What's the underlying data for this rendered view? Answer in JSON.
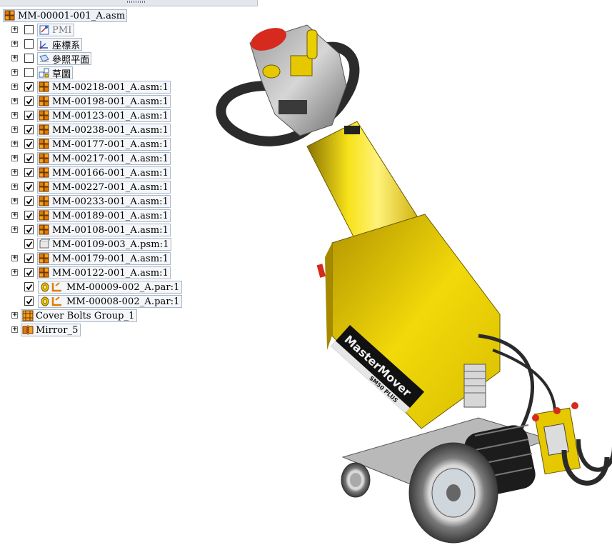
{
  "tree": {
    "root": {
      "label": "MM-00001-001_A.asm",
      "icon": "assembly-icon"
    },
    "items": [
      {
        "label": "PMI",
        "icon": "pmi-icon",
        "checked": false,
        "expand": true,
        "grey": true
      },
      {
        "label": "座標系",
        "icon": "coordinate-system-icon",
        "checked": false,
        "expand": true
      },
      {
        "label": "參照平面",
        "icon": "reference-plane-icon",
        "checked": false,
        "expand": true
      },
      {
        "label": "草圖",
        "icon": "sketch-icon",
        "checked": false,
        "expand": true
      },
      {
        "label": "MM-00218-001_A.asm:1",
        "icon": "assembly-icon",
        "checked": true,
        "expand": true
      },
      {
        "label": "MM-00198-001_A.asm:1",
        "icon": "assembly-icon",
        "checked": true,
        "expand": true
      },
      {
        "label": "MM-00123-001_A.asm:1",
        "icon": "assembly-icon",
        "checked": true,
        "expand": true
      },
      {
        "label": "MM-00238-001_A.asm:1",
        "icon": "assembly-icon",
        "checked": true,
        "expand": true
      },
      {
        "label": "MM-00177-001_A.asm:1",
        "icon": "assembly-icon",
        "checked": true,
        "expand": true
      },
      {
        "label": "MM-00217-001_A.asm:1",
        "icon": "assembly-icon",
        "checked": true,
        "expand": true
      },
      {
        "label": "MM-00166-001_A.asm:1",
        "icon": "assembly-icon",
        "checked": true,
        "expand": true
      },
      {
        "label": "MM-00227-001_A.asm:1",
        "icon": "assembly-icon",
        "checked": true,
        "expand": true
      },
      {
        "label": "MM-00233-001_A.asm:1",
        "icon": "assembly-icon",
        "checked": true,
        "expand": true
      },
      {
        "label": "MM-00189-001_A.asm:1",
        "icon": "assembly-icon",
        "checked": true,
        "expand": true
      },
      {
        "label": "MM-00108-001_A.asm:1",
        "icon": "assembly-icon",
        "checked": true,
        "expand": true
      },
      {
        "label": "MM-00109-003_A.psm:1",
        "icon": "sheet-metal-part-icon",
        "checked": true,
        "expand": false
      },
      {
        "label": "MM-00179-001_A.asm:1",
        "icon": "assembly-icon",
        "checked": true,
        "expand": true
      },
      {
        "label": "MM-00122-001_A.asm:1",
        "icon": "assembly-icon",
        "checked": true,
        "expand": true
      },
      {
        "label": "MM-00009-002_A.par:1",
        "icon": "part-icon",
        "checked": true,
        "expand": false,
        "sub": true
      },
      {
        "label": "MM-00008-002_A.par:1",
        "icon": "part-icon",
        "checked": true,
        "expand": false,
        "sub": true
      },
      {
        "label": "Cover Bolts Group_1",
        "icon": "pattern-group-icon",
        "checked": null,
        "expand": true
      },
      {
        "label": "Mirror_5",
        "icon": "mirror-icon",
        "checked": null,
        "expand": true
      }
    ]
  },
  "viewport": {
    "brand": "MasterMover",
    "model": "SM50 PLUS",
    "body_color": "#f2d600",
    "accent_color": "#d9261c"
  }
}
